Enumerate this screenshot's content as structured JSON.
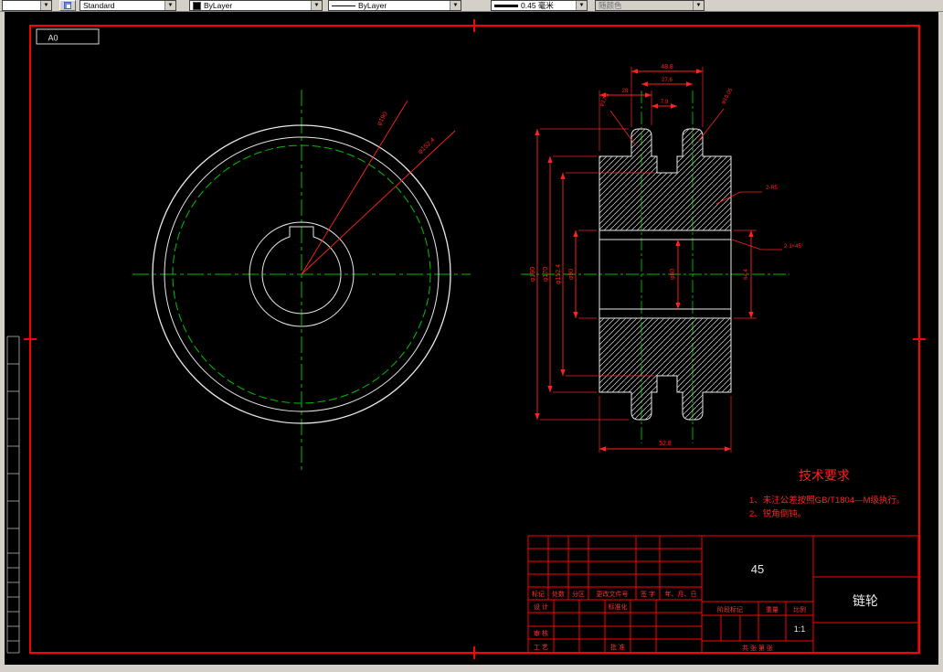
{
  "toolbar": {
    "nav_combo": "",
    "style_combo": "Standard",
    "color_combo": "ByLayer",
    "linetype_combo": "ByLayer",
    "lineweight_combo": "0.45 毫米",
    "plotstyle_combo": "随颜色",
    "dropdown_arrow": "▼"
  },
  "sheet": {
    "format_label": "A0"
  },
  "front_view": {
    "dim_outer": "φ190",
    "dim_pitch": "φ152.4"
  },
  "section_view": {
    "dim_width_over_teeth": "48.8",
    "dim_row_spacing": "27.6",
    "dim_28": "28",
    "dim_7_9": "7.9",
    "dim_roller_left": "φ17.8",
    "dim_roller_right": "φ19.05",
    "dim_left_1": "φ190",
    "dim_left_2": "φ170",
    "dim_left_3": "φ152.4",
    "dim_left_4": "φ90",
    "dim_bore": "φ60",
    "dim_right_1": "64.4",
    "leader_fillet": "2-R5",
    "leader_chamfer": "2-1×45°",
    "dim_bottom": "52.8"
  },
  "tech_req": {
    "title": "技术要求",
    "item1": "1、未注公差按照GB/T1804—M级执行。",
    "item2": "2、锐角倒钝。"
  },
  "title_block": {
    "material": "45",
    "part_name": "链轮",
    "scale_value": "1:1",
    "col_mark": "标记",
    "col_count": "处数",
    "col_zone": "分区",
    "col_doc": "更改文件号",
    "col_sign": "签 字",
    "col_date": "年、月、日",
    "row_design": "设 计",
    "row_standard": "标准化",
    "row_check": "审 核",
    "row_process": "工 艺",
    "row_approve": "批 准",
    "stage_label": "阶段标记",
    "weight_label": "重量",
    "scale_label": "比例",
    "sheet_label": "共  张  第  张"
  },
  "colors": {
    "dimension_red": "#ff2222",
    "centerline_green": "#00c000",
    "outline_white": "#e8e8e8",
    "toolbar_gray": "#d4d0c8"
  }
}
